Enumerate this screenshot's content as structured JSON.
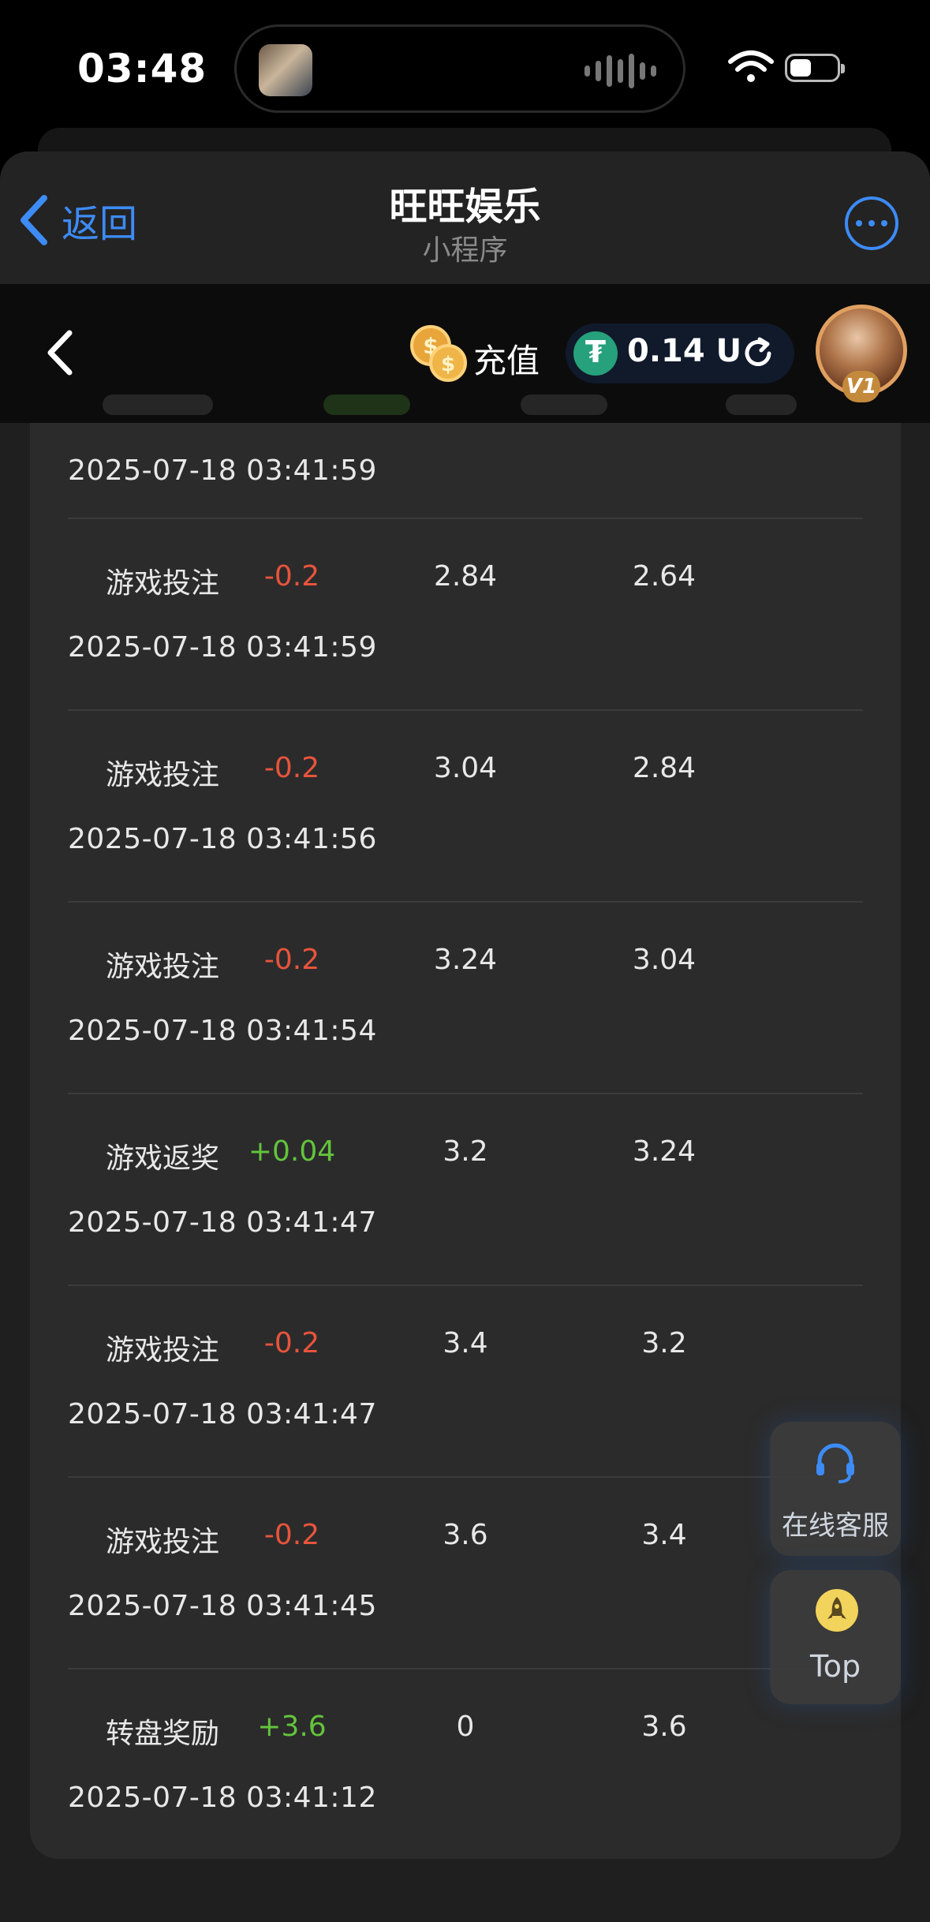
{
  "status_bar": {
    "time": "03:48"
  },
  "nav": {
    "back_label": "返回",
    "title": "旺旺娱乐",
    "subtitle": "小程序"
  },
  "header": {
    "recharge_label": "充值",
    "balance": "0.14 U",
    "currency_symbol": "₮",
    "vip_level": "V1"
  },
  "records": {
    "top_time": "2025-07-18 03:41:59",
    "rows": [
      {
        "type": "游戏投注",
        "amount": "-0.2",
        "before": "2.84",
        "after": "2.64",
        "time": "2025-07-18 03:41:59",
        "sign": "neg"
      },
      {
        "type": "游戏投注",
        "amount": "-0.2",
        "before": "3.04",
        "after": "2.84",
        "time": "2025-07-18 03:41:56",
        "sign": "neg"
      },
      {
        "type": "游戏投注",
        "amount": "-0.2",
        "before": "3.24",
        "after": "3.04",
        "time": "2025-07-18 03:41:54",
        "sign": "neg"
      },
      {
        "type": "游戏返奖",
        "amount": "+0.04",
        "before": "3.2",
        "after": "3.24",
        "time": "2025-07-18 03:41:47",
        "sign": "pos"
      },
      {
        "type": "游戏投注",
        "amount": "-0.2",
        "before": "3.4",
        "after": "3.2",
        "time": "2025-07-18 03:41:47",
        "sign": "neg"
      },
      {
        "type": "游戏投注",
        "amount": "-0.2",
        "before": "3.6",
        "after": "3.4",
        "time": "2025-07-18 03:41:45",
        "sign": "neg"
      },
      {
        "type": "转盘奖励",
        "amount": "+3.6",
        "before": "0",
        "after": "3.6",
        "time": "2025-07-18 03:41:12",
        "sign": "pos"
      }
    ]
  },
  "floating": {
    "service_label": "在线客服",
    "top_label": "Top"
  },
  "colors": {
    "accent": "#3d8bf5",
    "negative": "#e8543c",
    "positive": "#63c43c",
    "tether": "#26a17b"
  },
  "icons": [
    "wifi-icon",
    "battery-icon",
    "back-chevron-icon",
    "more-icon",
    "coins-icon",
    "tether-icon",
    "refresh-icon",
    "headset-icon",
    "rocket-icon"
  ]
}
